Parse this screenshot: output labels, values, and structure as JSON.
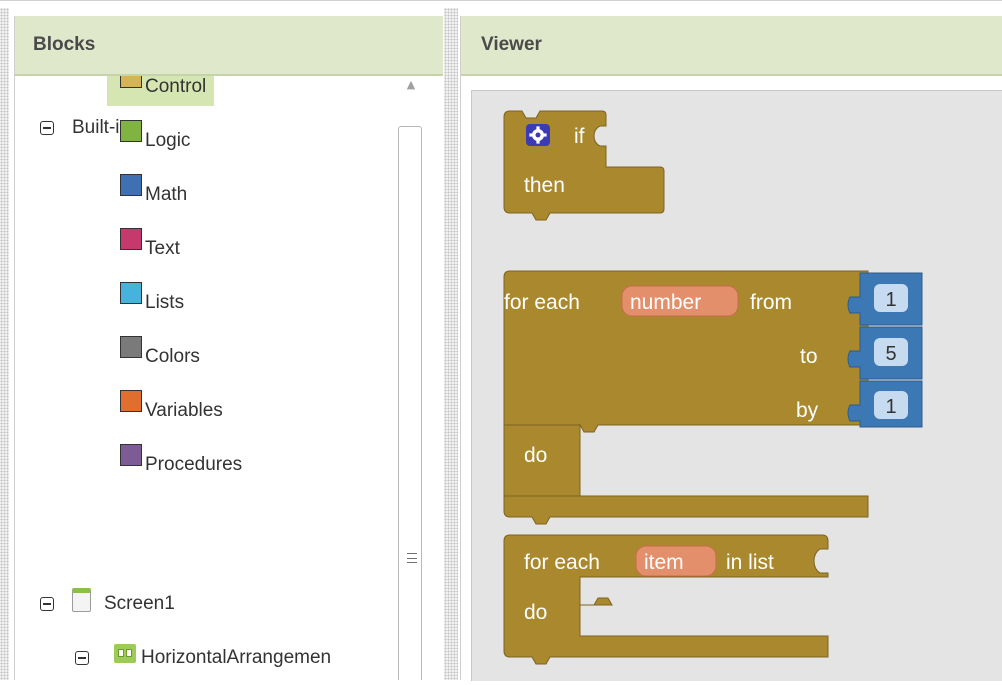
{
  "blocks_panel": {
    "title": "Blocks",
    "built_in_label": "Built-in",
    "categories": [
      {
        "label": "Control",
        "color": "#d6b456",
        "selected": true
      },
      {
        "label": "Logic",
        "color": "#7fb443"
      },
      {
        "label": "Math",
        "color": "#3f70b4"
      },
      {
        "label": "Text",
        "color": "#c5396c"
      },
      {
        "label": "Lists",
        "color": "#45b3db"
      },
      {
        "label": "Colors",
        "color": "#7a7a7a"
      },
      {
        "label": "Variables",
        "color": "#e06e2e"
      },
      {
        "label": "Procedures",
        "color": "#7d5c95"
      }
    ],
    "components": {
      "screen_label": "Screen1",
      "arrangement_label": "HorizontalArrangemen"
    },
    "icons": {
      "collapse": "minus-box-icon",
      "screen": "screen-icon",
      "arrangement": "horizontal-arrangement-icon",
      "scroll_up": "scroll-up-arrow-icon"
    }
  },
  "viewer": {
    "title": "Viewer",
    "colors": {
      "control": "#a9882e",
      "variable": "#e48f6c",
      "math": "#3c78b4",
      "mutator": "#3b3bb5"
    },
    "blocks": {
      "if_block": {
        "if_label": "if",
        "then_label": "then",
        "mutator_icon": "gear-icon"
      },
      "for_range": {
        "for_each_label": "for each",
        "variable": "number",
        "from_label": "from",
        "to_label": "to",
        "by_label": "by",
        "do_label": "do",
        "from_value": "1",
        "to_value": "5",
        "by_value": "1"
      },
      "for_list": {
        "for_each_label": "for each",
        "variable": "item",
        "in_list_label": "in list",
        "do_label": "do"
      }
    }
  }
}
